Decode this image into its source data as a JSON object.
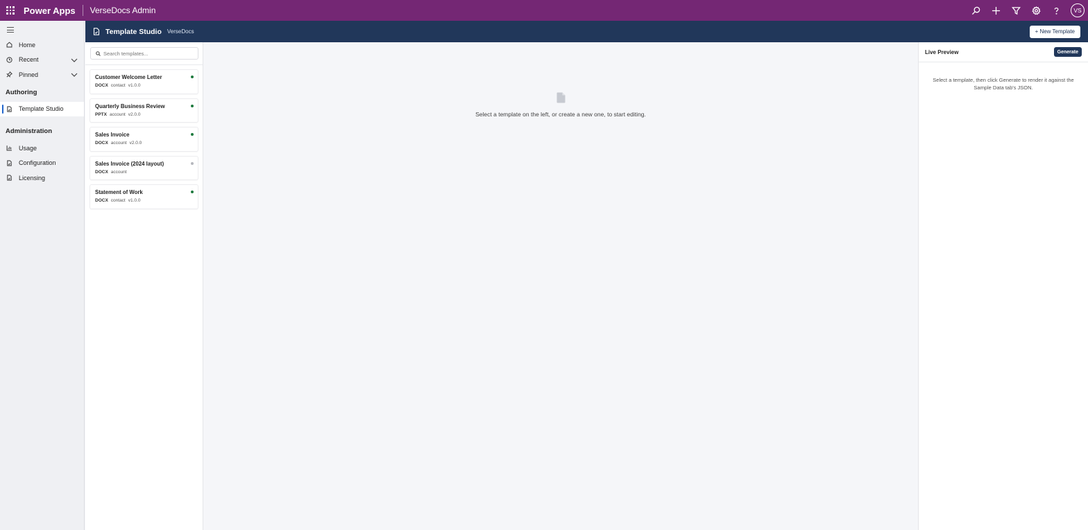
{
  "topbar": {
    "app_name": "Power Apps",
    "environment": "VerseDocs Admin",
    "icons": [
      "search-icon",
      "add-icon",
      "filter-icon",
      "settings-icon",
      "help-icon"
    ],
    "avatar_initials": "VS"
  },
  "leftnav": {
    "items_top": [
      {
        "label": "Home",
        "icon": "home-icon"
      },
      {
        "label": "Recent",
        "icon": "clock-icon",
        "expandable": true
      },
      {
        "label": "Pinned",
        "icon": "pin-icon",
        "expandable": true
      }
    ],
    "groups": [
      {
        "title": "Authoring",
        "items": [
          {
            "label": "Template Studio",
            "icon": "document-icon",
            "active": true
          }
        ]
      },
      {
        "title": "Administration",
        "items": [
          {
            "label": "Usage",
            "icon": "chart-icon"
          },
          {
            "label": "Configuration",
            "icon": "document-icon"
          },
          {
            "label": "Licensing",
            "icon": "document-icon"
          }
        ]
      }
    ]
  },
  "subheader": {
    "title": "Template Studio",
    "subtitle": "VerseDocs",
    "new_button": "+ New Template"
  },
  "search": {
    "placeholder": "Search templates..."
  },
  "templates": [
    {
      "name": "Customer Welcome Letter",
      "format": "DOCX",
      "entity": "contact",
      "version": "v1.0.0",
      "status_color": "#1e7a3e"
    },
    {
      "name": "Quarterly Business Review",
      "format": "PPTX",
      "entity": "account",
      "version": "v2.0.0",
      "status_color": "#1e7a3e"
    },
    {
      "name": "Sales Invoice",
      "format": "DOCX",
      "entity": "account",
      "version": "v2.0.0",
      "status_color": "#1e7a3e"
    },
    {
      "name": "Sales Invoice (2024 layout)",
      "format": "DOCX",
      "entity": "account",
      "version": "",
      "status_color": "#b5b7bd"
    },
    {
      "name": "Statement of Work",
      "format": "DOCX",
      "entity": "contact",
      "version": "v1.0.0",
      "status_color": "#1e7a3e"
    }
  ],
  "center": {
    "empty_message": "Select a template on the left, or create a new one, to start editing."
  },
  "preview": {
    "title": "Live Preview",
    "generate_button": "Generate",
    "hint": "Select a template, then click Generate to render it against the Sample Data tab's JSON."
  },
  "colors": {
    "brand_bar": "#742774",
    "subheader": "#21375a",
    "active_indicator": "#2266cc",
    "status_active": "#1e7a3e",
    "status_inactive": "#b5b7bd"
  }
}
